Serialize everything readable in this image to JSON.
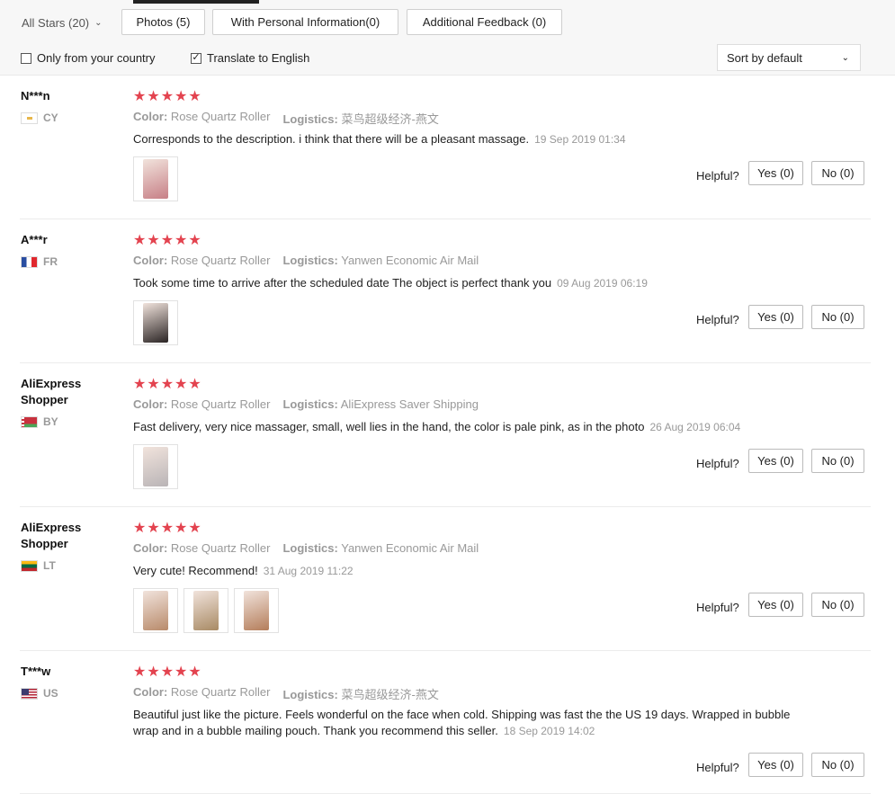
{
  "filters": {
    "all_stars": "All Stars (20)",
    "photos": "Photos (5)",
    "personal_info": "With Personal Information(0)",
    "additional": "Additional Feedback (0)",
    "only_country": "Only from your country",
    "only_country_checked": false,
    "translate": "Translate to English",
    "translate_checked": true,
    "sort": "Sort by default"
  },
  "labels": {
    "color": "Color:",
    "logistics": "Logistics:",
    "helpful": "Helpful?",
    "stars": "★★★★★"
  },
  "reviews": [
    {
      "user": "N***n",
      "country": "CY",
      "flag": "cy",
      "rating": 5,
      "color": "Rose Quartz Roller",
      "logistics": "菜鸟超级经济-燕文",
      "text": "Corresponds to the description. i think that there will be a pleasant massage.",
      "date": "19 Sep 2019 01:34",
      "yes": "Yes (0)",
      "no": "No (0)",
      "photo_colors": [
        "#c77f86"
      ]
    },
    {
      "user": "A***r",
      "country": "FR",
      "flag": "fr",
      "rating": 5,
      "color": "Rose Quartz Roller",
      "logistics": "Yanwen Economic Air Mail",
      "text": "Took some time to arrive after the scheduled date The object is perfect thank you",
      "date": "09 Aug 2019 06:19",
      "yes": "Yes (0)",
      "no": "No (0)",
      "photo_colors": [
        "#2a2424"
      ]
    },
    {
      "user": "AliExpress Shopper",
      "country": "BY",
      "flag": "by",
      "rating": 5,
      "color": "Rose Quartz Roller",
      "logistics": "AliExpress Saver Shipping",
      "text": "Fast delivery, very nice massager, small, well lies in the hand, the color is pale pink, as in the photo",
      "date": "26 Aug 2019 06:04",
      "yes": "Yes (0)",
      "no": "No (0)",
      "photo_colors": [
        "#b9b4b6"
      ]
    },
    {
      "user": "AliExpress Shopper",
      "country": "LT",
      "flag": "lt",
      "rating": 5,
      "color": "Rose Quartz Roller",
      "logistics": "Yanwen Economic Air Mail",
      "text": "Very cute! Recommend!",
      "date": "31 Aug 2019 11:22",
      "yes": "Yes (0)",
      "no": "No (0)",
      "photo_colors": [
        "#b88a6a",
        "#a88a64",
        "#b47d5a"
      ]
    },
    {
      "user": "T***w",
      "country": "US",
      "flag": "us",
      "rating": 5,
      "color": "Rose Quartz Roller",
      "logistics": "菜鸟超级经济-燕文",
      "text": "Beautiful just like the picture. Feels wonderful on the face when cold. Shipping was fast the the US 19 days. Wrapped in bubble wrap and in a bubble mailing pouch. Thank you recommend this seller.",
      "date": "18 Sep 2019 14:02",
      "yes": "Yes (0)",
      "no": "No (0)",
      "photo_colors": []
    }
  ]
}
